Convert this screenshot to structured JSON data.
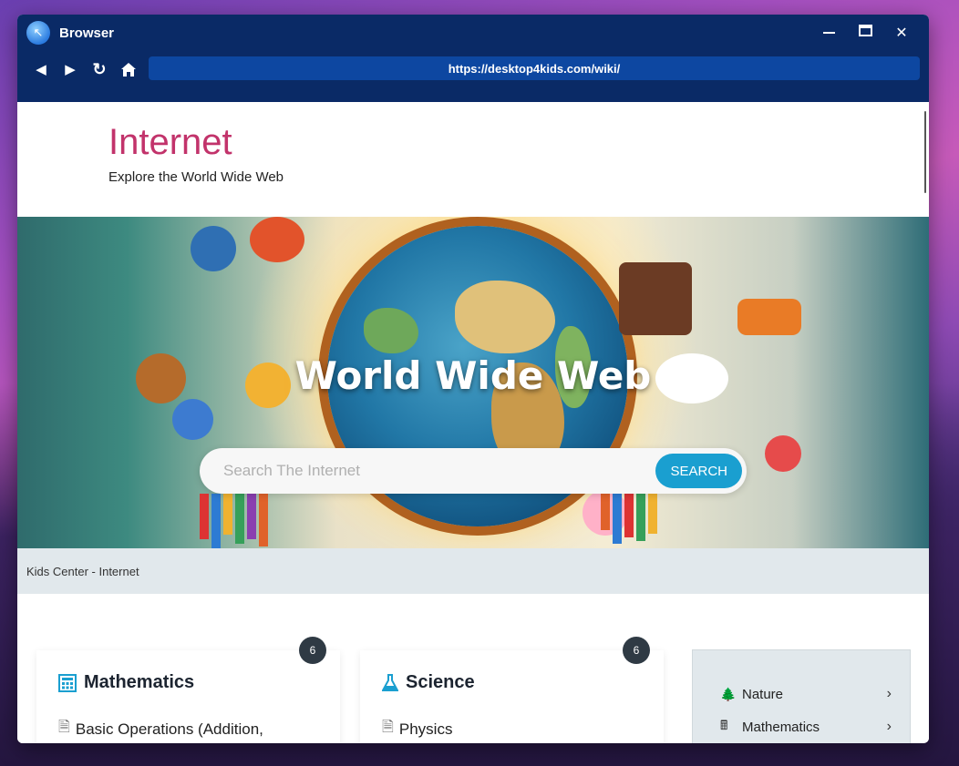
{
  "window": {
    "title": "Browser"
  },
  "nav": {
    "url": "https://desktop4kids.com/wiki/"
  },
  "page": {
    "title": "Internet",
    "subtitle": "Explore the World Wide Web"
  },
  "hero": {
    "title": "World Wide Web",
    "search_placeholder": "Search The Internet",
    "search_button": "SEARCH"
  },
  "breadcrumb": "Kids Center - Internet",
  "cards": [
    {
      "title": "Mathematics",
      "icon": "calculator-icon",
      "count": "6",
      "first_item": "Basic Operations (Addition,"
    },
    {
      "title": "Science",
      "icon": "flask-icon",
      "count": "6",
      "first_item": "Physics"
    }
  ],
  "sidebar": {
    "items": [
      {
        "label": "Nature",
        "icon": "tree-icon"
      },
      {
        "label": "Mathematics",
        "icon": "calculator-icon"
      }
    ]
  },
  "colors": {
    "title_bar": "#0a2a66",
    "url_bar": "#0d47a1",
    "page_title": "#c2336b",
    "accent": "#1a9fd0"
  }
}
